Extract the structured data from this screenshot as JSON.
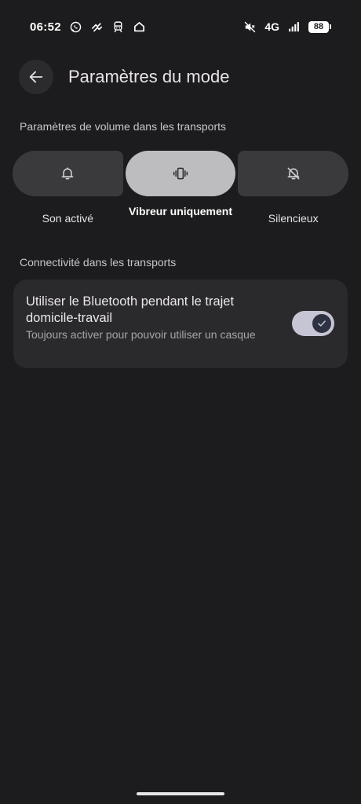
{
  "status_bar": {
    "time": "06:52",
    "network": "4G",
    "battery": "88",
    "icons": [
      "whatsapp-icon",
      "data-saver-icon",
      "train-icon",
      "home-icon",
      "mute-icon",
      "signal-icon"
    ]
  },
  "header": {
    "title": "Paramètres du mode",
    "back_icon": "arrow-left-icon"
  },
  "volume_section": {
    "label": "Paramètres de volume dans les transports",
    "options": [
      {
        "label": "Son activé",
        "icon": "bell-icon",
        "selected": false
      },
      {
        "label": "Vibreur uniquement",
        "icon": "vibrate-icon",
        "selected": true
      },
      {
        "label": "Silencieux",
        "icon": "bell-off-icon",
        "selected": false
      }
    ]
  },
  "connectivity_section": {
    "label": "Connectivité dans les transports",
    "bluetooth": {
      "title": "Utiliser le Bluetooth pendant le trajet domicile-travail",
      "subtitle": "Toujours activer pour pouvoir utiliser un casque",
      "enabled": true
    }
  },
  "colors": {
    "background": "#1c1c1e",
    "segment": "#3a3a3d",
    "segment_selected": "#bdbdbf",
    "card": "#2a2a2d",
    "toggle_track": "#c6c5d3"
  }
}
